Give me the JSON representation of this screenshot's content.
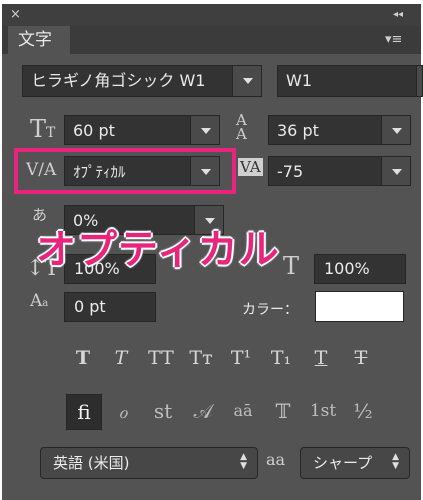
{
  "window": {
    "close_icon": "×",
    "collapse_icon": "◂◂",
    "menu_icon": "▾≡"
  },
  "panel": {
    "tab_label": "文字"
  },
  "font": {
    "family": "ヒラギノ角ゴシック W1",
    "style": "W1"
  },
  "size": {
    "value": "60 pt"
  },
  "leading": {
    "value": "36 pt"
  },
  "kerning": {
    "value": "ｵﾌﾟﾃｨｶﾙ"
  },
  "tracking": {
    "value": "-75"
  },
  "tsume": {
    "value": "0%"
  },
  "annotation": {
    "text": "オプティカル",
    "color": "#e8247c"
  },
  "vertical_scale": {
    "value": "100%"
  },
  "horizontal_scale": {
    "value": "100%"
  },
  "baseline": {
    "value": "0 pt"
  },
  "color_label": "カラー：",
  "text_color": "#ffffff",
  "style_buttons": [
    "T",
    "T",
    "TT",
    "Tт",
    "T¹",
    "T₁",
    "T",
    "T"
  ],
  "opentype_buttons": [
    "fi",
    "ℴ",
    "st",
    "𝒜",
    "aā",
    "𝕋",
    "1st",
    "½"
  ],
  "language": {
    "value": "英語 (米国)"
  },
  "antialias": {
    "icon": "aa",
    "value": "シャープ"
  }
}
